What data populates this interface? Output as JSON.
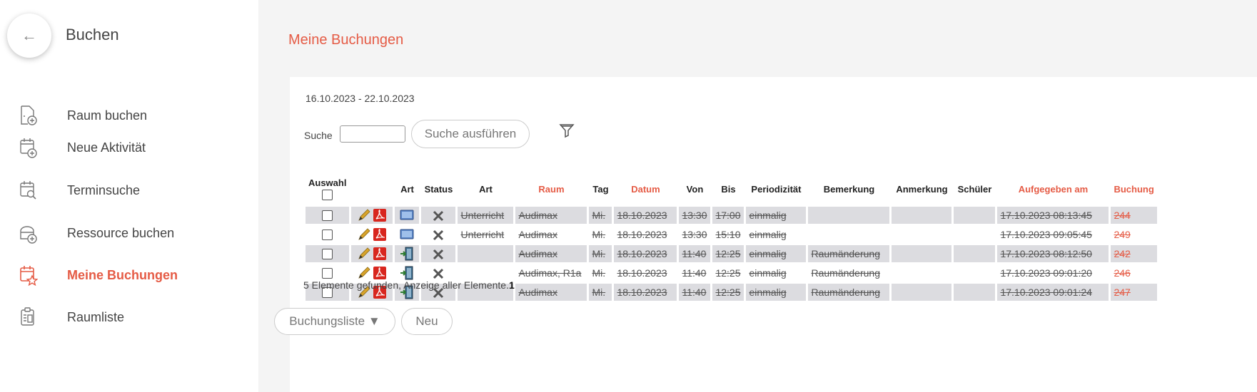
{
  "sidebar": {
    "back_icon": "arrow-left-icon",
    "title": "Buchen",
    "items": [
      {
        "label": "Raum buchen",
        "icon": "file-plus-icon",
        "active": false
      },
      {
        "label": "Neue Aktivität",
        "icon": "calendar-plus-icon",
        "active": false
      },
      {
        "label": "Terminsuche",
        "icon": "calendar-search-icon",
        "active": false
      },
      {
        "label": "Ressource buchen",
        "icon": "resource-plus-icon",
        "active": false
      },
      {
        "label": "Meine Buchungen",
        "icon": "calendar-star-icon",
        "active": true
      },
      {
        "label": "Raumliste",
        "icon": "room-list-icon",
        "active": false
      }
    ]
  },
  "main": {
    "title": "Meine Buchungen",
    "date_range": "16.10.2023 - 22.10.2023",
    "search_label": "Suche",
    "search_value": "",
    "search_button": "Suche ausführen",
    "filter_icon": "filter-icon",
    "table": {
      "headers": [
        "Auswahl",
        "",
        "Art",
        "Status",
        "Art",
        "Raum",
        "Tag",
        "Datum",
        "Von",
        "Bis",
        "Periodizität",
        "Bemerkung",
        "Anmerkung",
        "Schüler",
        "Aufgegeben am",
        "Buchung"
      ],
      "rows": [
        {
          "art_icon": "monitor-icon",
          "art": "Unterricht",
          "raum": "Audimax",
          "tag": "Mi.",
          "datum": "18.10.2023",
          "von": "13:30",
          "bis": "17:00",
          "periodizitaet": "einmalig",
          "bemerkung": "",
          "anmerkung": "",
          "schueler": "",
          "aufgegeben": "17.10.2023 08:13:45",
          "buchung": "244"
        },
        {
          "art_icon": "monitor-icon",
          "art": "Unterricht",
          "raum": "Audimax",
          "tag": "Mi.",
          "datum": "18.10.2023",
          "von": "13:30",
          "bis": "15:10",
          "periodizitaet": "einmalig",
          "bemerkung": "",
          "anmerkung": "",
          "schueler": "",
          "aufgegeben": "17.10.2023 09:05:45",
          "buchung": "249"
        },
        {
          "art_icon": "room-change-icon",
          "art": "",
          "raum": "Audimax",
          "tag": "Mi.",
          "datum": "18.10.2023",
          "von": "11:40",
          "bis": "12:25",
          "periodizitaet": "einmalig",
          "bemerkung": "Raumänderung",
          "anmerkung": "",
          "schueler": "",
          "aufgegeben": "17.10.2023 08:12:50",
          "buchung": "242"
        },
        {
          "art_icon": "room-change-icon",
          "art": "",
          "raum": "Audimax, R1a",
          "tag": "Mi.",
          "datum": "18.10.2023",
          "von": "11:40",
          "bis": "12:25",
          "periodizitaet": "einmalig",
          "bemerkung": "Raumänderung",
          "anmerkung": "",
          "schueler": "",
          "aufgegeben": "17.10.2023 09:01:20",
          "buchung": "246"
        },
        {
          "art_icon": "room-change-icon",
          "art": "",
          "raum": "Audimax",
          "tag": "Mi.",
          "datum": "18.10.2023",
          "von": "11:40",
          "bis": "12:25",
          "periodizitaet": "einmalig",
          "bemerkung": "Raumänderung",
          "anmerkung": "",
          "schueler": "",
          "aufgegeben": "17.10.2023 09:01:24",
          "buchung": "247"
        }
      ]
    },
    "found_text": "5 Elemente gefunden, Anzeige aller Elemente.",
    "found_page": "1",
    "buchungsliste_button": "Buchungsliste ▼",
    "neu_button": "Neu"
  },
  "colors": {
    "accent": "#e55b45",
    "row_shade": "#dcdce0"
  }
}
